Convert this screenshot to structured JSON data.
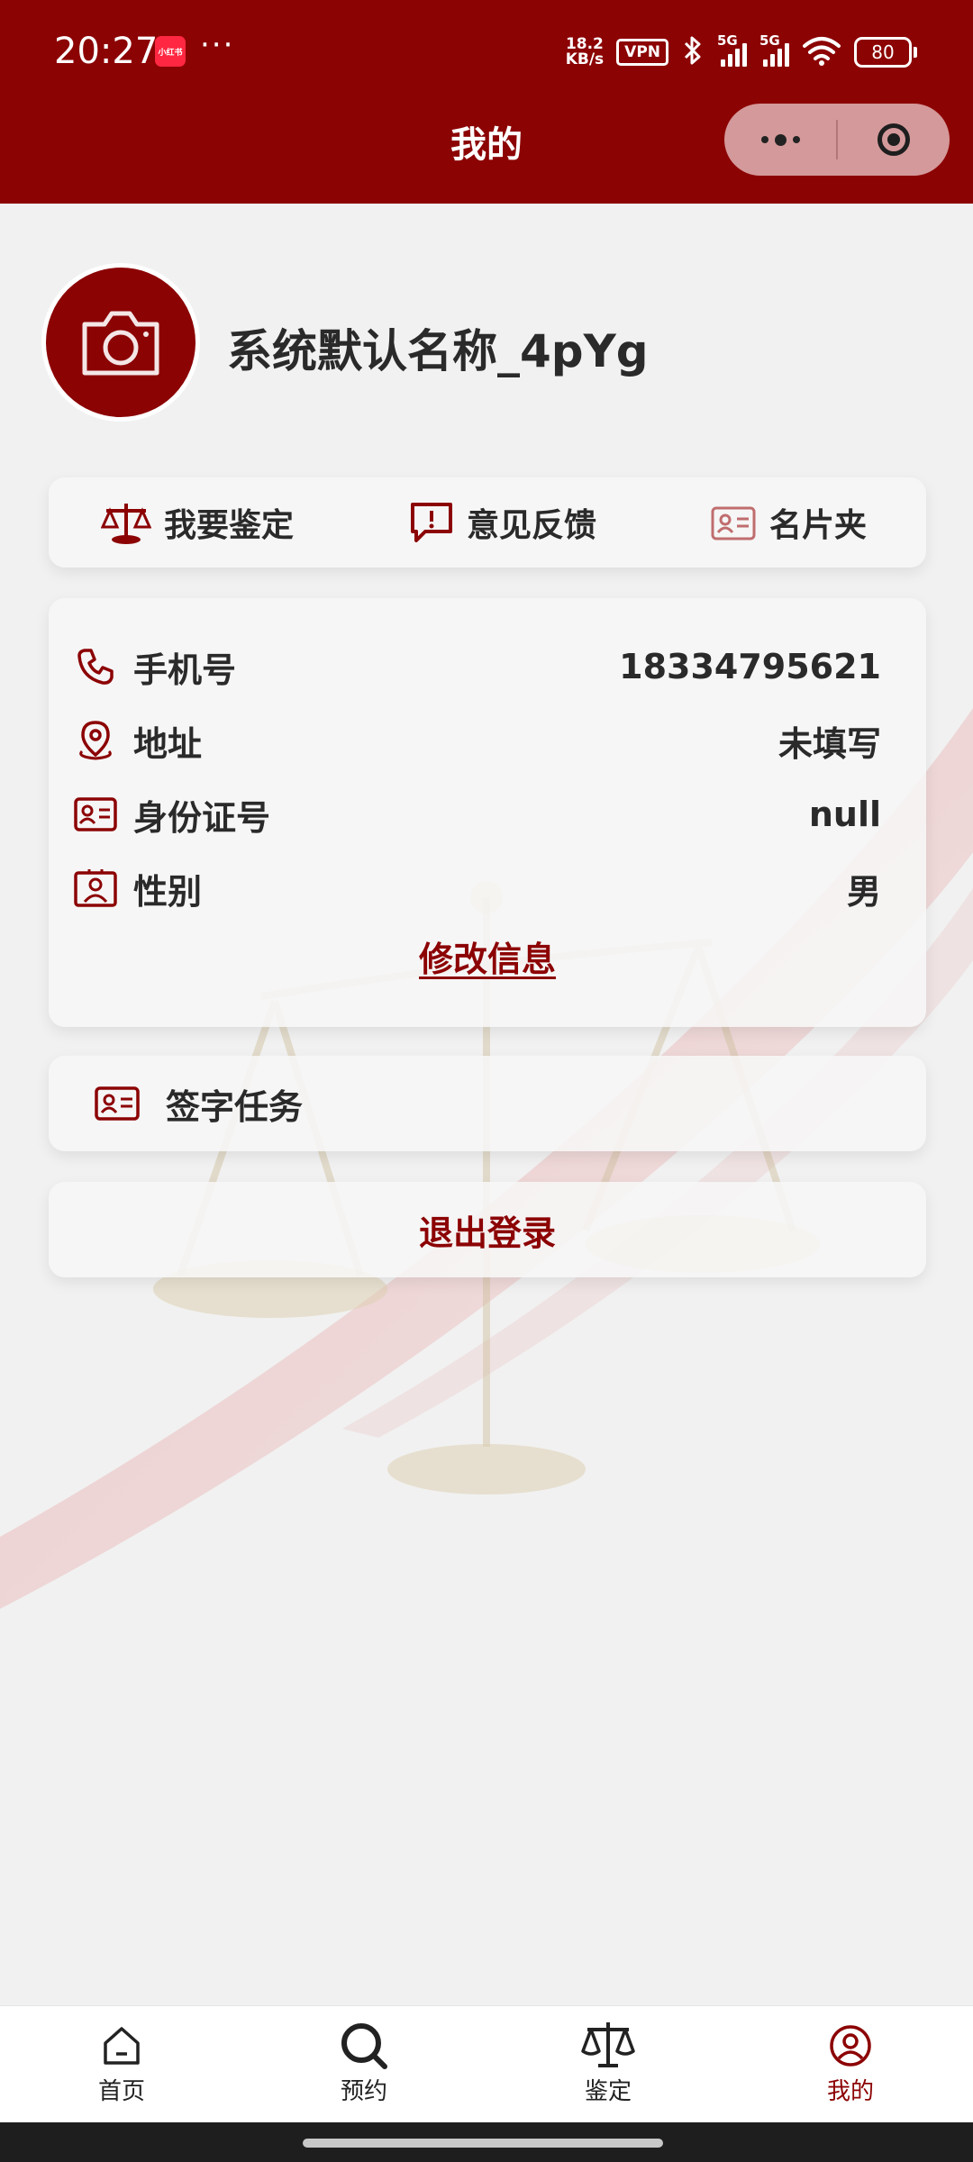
{
  "status_bar": {
    "time": "20:27",
    "app_badge": "小红书",
    "dots": "···",
    "net_speed_value": "18.2",
    "net_speed_unit": "KB/s",
    "vpn": "VPN",
    "signal_1": "5G",
    "signal_2": "5G",
    "battery": "80"
  },
  "nav": {
    "title": "我的"
  },
  "profile": {
    "username": "系统默认名称_4pYg"
  },
  "actions": [
    {
      "label": "我要鉴定",
      "icon": "scale-icon"
    },
    {
      "label": "意见反馈",
      "icon": "feedback-icon"
    },
    {
      "label": "名片夹",
      "icon": "card-holder-icon"
    }
  ],
  "info": {
    "rows": [
      {
        "label": "手机号",
        "value": "18334795621",
        "icon": "phone-icon"
      },
      {
        "label": "地址",
        "value": "未填写",
        "icon": "location-icon"
      },
      {
        "label": "身份证号",
        "value": "null",
        "icon": "id-card-icon"
      },
      {
        "label": "性别",
        "value": "男",
        "icon": "person-badge-icon"
      }
    ],
    "edit_label": "修改信息"
  },
  "sign_task": {
    "label": "签字任务",
    "icon": "id-card-icon"
  },
  "logout": {
    "label": "退出登录"
  },
  "tabs": [
    {
      "label": "首页",
      "icon": "home-icon",
      "active": false
    },
    {
      "label": "预约",
      "icon": "search-icon",
      "active": false
    },
    {
      "label": "鉴定",
      "icon": "scale-icon",
      "active": false
    },
    {
      "label": "我的",
      "icon": "user-circle-icon",
      "active": true
    }
  ],
  "colors": {
    "brand": "#8c0304",
    "capsule": "#d4999a",
    "text": "#2a2a2a"
  }
}
